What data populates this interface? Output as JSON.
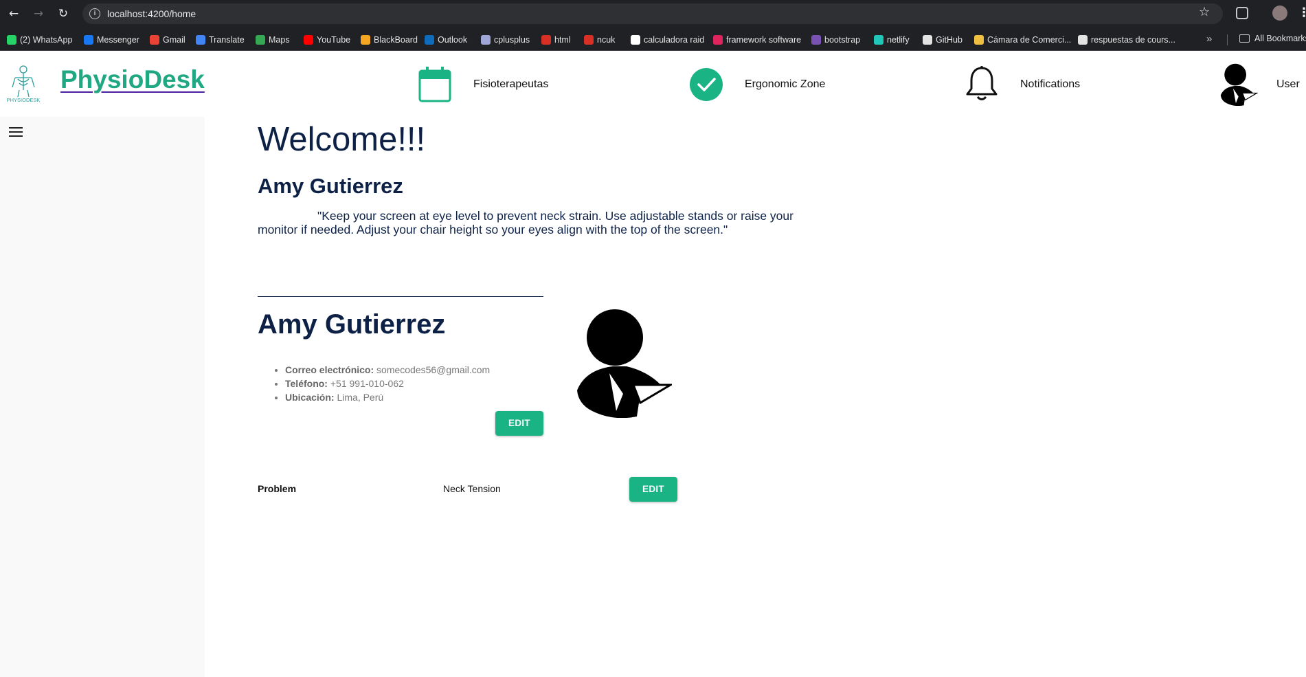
{
  "browser": {
    "url": "localhost:4200/home",
    "bookmarks": [
      {
        "label": "(2) WhatsApp",
        "icon": "whatsapp-icon",
        "color": "#25d366"
      },
      {
        "label": "Messenger",
        "icon": "facebook-icon",
        "color": "#1877f2"
      },
      {
        "label": "Gmail",
        "icon": "gmail-icon",
        "color": "#ea4335"
      },
      {
        "label": "Translate",
        "icon": "translate-icon",
        "color": "#4285f4"
      },
      {
        "label": "Maps",
        "icon": "maps-icon",
        "color": "#34a853"
      },
      {
        "label": "YouTube",
        "icon": "youtube-icon",
        "color": "#ff0000"
      },
      {
        "label": "BlackBoard",
        "icon": "blackboard-icon",
        "color": "#f5a623"
      },
      {
        "label": "Outlook",
        "icon": "outlook-icon",
        "color": "#0f6cbd"
      },
      {
        "label": "cplusplus",
        "icon": "cplusplus-icon",
        "color": "#a0a7d8"
      },
      {
        "label": "html",
        "icon": "html-icon",
        "color": "#d93025"
      },
      {
        "label": "ncuk",
        "icon": "ncuk-icon",
        "color": "#d93025"
      },
      {
        "label": "calculadora raid",
        "icon": "raid-icon",
        "color": "#ffffff"
      },
      {
        "label": "framework software",
        "icon": "framework-icon",
        "color": "#e0245e"
      },
      {
        "label": "bootstrap",
        "icon": "bootstrap-icon",
        "color": "#7952b3"
      },
      {
        "label": "netlify",
        "icon": "netlify-icon",
        "color": "#20c6b7"
      },
      {
        "label": "GitHub",
        "icon": "github-icon",
        "color": "#e3e3e3"
      },
      {
        "label": "Cámara de Comerci...",
        "icon": "camara-icon",
        "color": "#f0c040"
      },
      {
        "label": "respuestas de cours...",
        "icon": "coursera-icon",
        "color": "#e3e3e3"
      }
    ],
    "all_bookmarks_label": "All Bookmarks"
  },
  "app": {
    "brand": "PhysioDesk",
    "logo_text": "PHYSIODESK",
    "accent_color": "#1ab383",
    "nav": {
      "fisio_label": "Fisioterapeutas",
      "ergonomic_label": "Ergonomic Zone",
      "notifications_label": "Notifications",
      "user_label": "User"
    }
  },
  "main": {
    "welcome": "Welcome!!!",
    "user_name": "Amy Gutierrez",
    "tip": "\"Keep your screen at eye level to prevent neck strain. Use adjustable stands or raise your monitor if needed. Adjust your chair height so your eyes align with the top of the screen.\""
  },
  "profile": {
    "name": "Amy Gutierrez",
    "email_label": "Correo electrónico:",
    "email": "somecodes56@gmail.com",
    "phone_label": "Teléfono:",
    "phone": "+51 991-010-062",
    "location_label": "Ubicación:",
    "location": "Lima, Perú",
    "edit_label": "EDIT"
  },
  "problem": {
    "label": "Problem",
    "value": "Neck Tension",
    "edit_label": "EDIT"
  }
}
